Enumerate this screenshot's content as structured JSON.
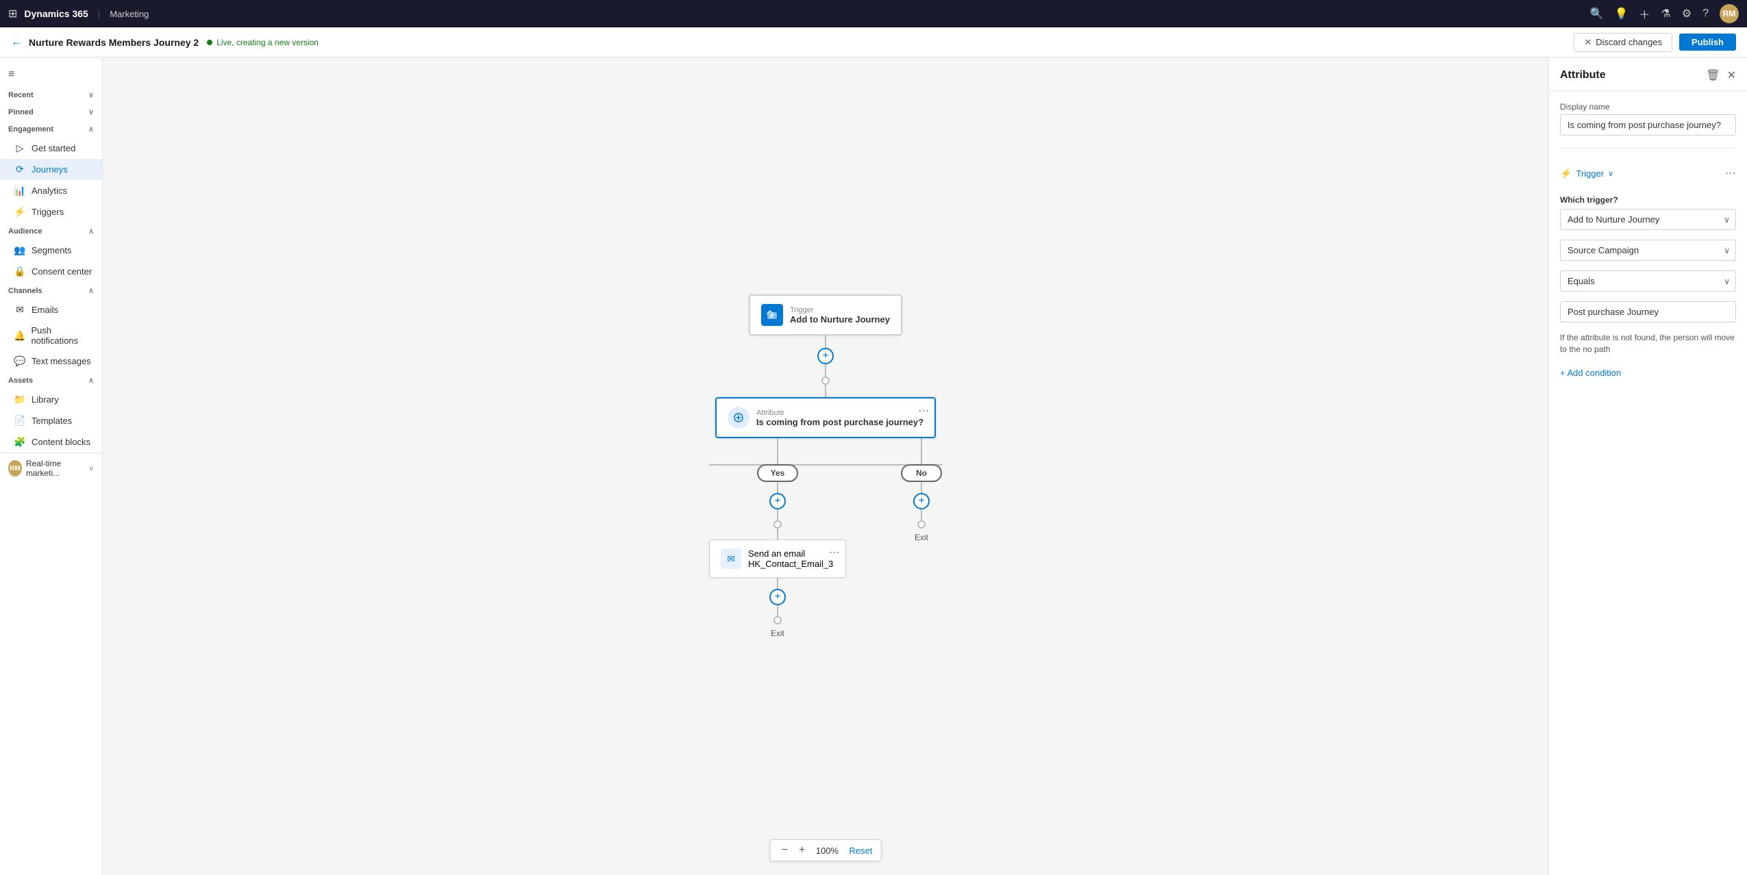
{
  "topnav": {
    "app_name": "Dynamics 365",
    "pipe": "|",
    "module": "Marketing",
    "avatar_initials": "RM"
  },
  "secondbar": {
    "title": "Nurture Rewards Members Journey 2",
    "status": "Live, creating a new version",
    "discard_label": "Discard changes",
    "publish_label": "Publish"
  },
  "sidebar": {
    "toggle": "≡",
    "recent_label": "Recent",
    "pinned_label": "Pinned",
    "engagement_label": "Engagement",
    "items_engagement": [
      {
        "label": "Get started",
        "icon": "▷"
      },
      {
        "label": "Journeys",
        "icon": "⟳"
      },
      {
        "label": "Analytics",
        "icon": "📊"
      },
      {
        "label": "Triggers",
        "icon": "⚡"
      }
    ],
    "audience_label": "Audience",
    "items_audience": [
      {
        "label": "Segments",
        "icon": "👥"
      },
      {
        "label": "Consent center",
        "icon": "🔒"
      }
    ],
    "channels_label": "Channels",
    "items_channels": [
      {
        "label": "Emails",
        "icon": "✉"
      },
      {
        "label": "Push notifications",
        "icon": "🔔"
      },
      {
        "label": "Text messages",
        "icon": "💬"
      }
    ],
    "assets_label": "Assets",
    "items_assets": [
      {
        "label": "Library",
        "icon": "📁"
      },
      {
        "label": "Templates",
        "icon": "📄"
      },
      {
        "label": "Content blocks",
        "icon": "🧩"
      }
    ],
    "footer_label": "Real-time marketi..."
  },
  "canvas": {
    "trigger_node": {
      "label_small": "Trigger",
      "label_main": "Add to Nurture Journey"
    },
    "attribute_node": {
      "label_small": "Attribute",
      "label_main": "Is coming from post purchase journey?"
    },
    "yes_label": "Yes",
    "no_label": "No",
    "email_node": {
      "label_small": "Send an email",
      "label_main": "HK_Contact_Email_3"
    },
    "exit_label": "Exit",
    "zoom_minus": "−",
    "zoom_plus": "+",
    "zoom_pct": "100%",
    "zoom_reset": "Reset"
  },
  "panel": {
    "title": "Attribute",
    "display_name_label": "Display name",
    "display_name_value": "Is coming from post purchase journey?",
    "trigger_label": "Trigger",
    "trigger_chevron": "∨",
    "which_trigger_label": "Which trigger?",
    "which_trigger_value": "Add to Nurture Journey",
    "source_campaign_value": "Source Campaign",
    "equals_value": "Equals",
    "post_purchase_value": "Post purchase Journey",
    "info_text": "If the attribute is not found, the person will move to the no path",
    "add_condition_label": "+ Add condition"
  }
}
